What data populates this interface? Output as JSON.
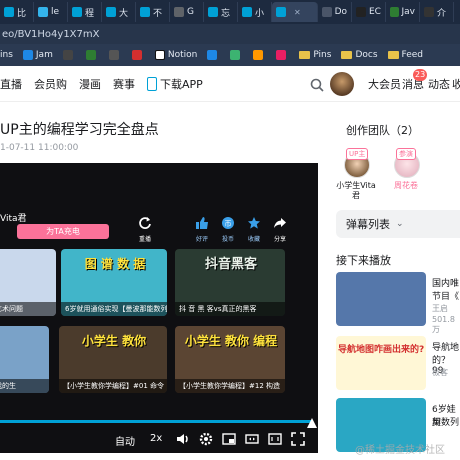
{
  "tabs": [
    {
      "label": "比",
      "color": "#00a1d6"
    },
    {
      "label": "le",
      "color": "#34b4eb"
    },
    {
      "label": "程",
      "color": "#00a1d6"
    },
    {
      "label": "大",
      "color": "#00a1d6"
    },
    {
      "label": "不",
      "color": "#00a1d6"
    },
    {
      "label": "G",
      "color": "#5f6368"
    },
    {
      "label": "忘",
      "color": "#00a1d6"
    },
    {
      "label": "小",
      "color": "#00a1d6"
    },
    {
      "label": "",
      "color": "#00a1d6"
    },
    {
      "label": "Do",
      "color": "#4a5568"
    },
    {
      "label": "EC",
      "color": "#222"
    },
    {
      "label": "Jav",
      "color": "#2e7d32"
    },
    {
      "label": "介",
      "color": "#333"
    }
  ],
  "url": "eo/BV1Ho4y1X7mX",
  "bookmarks": [
    {
      "label": "ins",
      "color": "#e06c75"
    },
    {
      "label": "Jam",
      "color": "#1e88e5"
    },
    {
      "label": "",
      "color": "#444"
    },
    {
      "label": "",
      "color": "#2e7d32"
    },
    {
      "label": "",
      "color": "#555"
    },
    {
      "label": "",
      "color": "#d32f2f"
    },
    {
      "label": "Notion",
      "color": "#fff"
    },
    {
      "label": "",
      "color": "#1e88e5"
    },
    {
      "label": "",
      "color": "#3cb371"
    },
    {
      "label": "",
      "color": "#ff9800"
    },
    {
      "label": "",
      "color": "#e91e63"
    }
  ],
  "bookmark_folders": [
    "Pins",
    "Docs",
    "Feed"
  ],
  "site_nav": {
    "links": [
      "直播",
      "会员购",
      "漫画",
      "赛事"
    ],
    "download_app": "下载APP",
    "vip": "大会员",
    "messages": "消息",
    "message_badge": "23",
    "dynamics": "动态",
    "favorites": "收"
  },
  "video": {
    "title": "UP主的编程学习完全盘点",
    "date": "1-07-11 11:00:00",
    "uploader_overlay": "Vita君",
    "charge_button": "为TA充电",
    "replay": "重播",
    "like": "好评",
    "coin": "投币",
    "favorite": "收藏",
    "share": "分享",
    "controls": {
      "auto": "自动",
      "speed": "2x"
    }
  },
  "end_screen": [
    {
      "caption": "的经济艺术问题",
      "bg": "#c9d8ec",
      "overlay": ""
    },
    {
      "caption": "6岁就用通俗实现【曼波那能数列】",
      "bg": "#41b5c9",
      "overlay": "图 谱 数 据"
    },
    {
      "caption": "抖 音 黑 客vs真正的黑客",
      "bg": "#2a3b32",
      "overlay": "抖音黑客"
    },
    {
      "caption": "，我，我的生",
      "bg": "#7aa2c8",
      "overlay": ""
    },
    {
      "caption": "【小学生教你学编程】#01 命令",
      "bg": "#4b3b2c",
      "overlay": "小学生 教你"
    },
    {
      "caption": "【小学生教你学编程】#12 构造",
      "bg": "#5b4533",
      "overlay": "小学生 教你 编程"
    }
  ],
  "sidebar": {
    "team_title": "创作团队（2）",
    "members": [
      {
        "tag": "UP主",
        "name": "小学生Vita君",
        "name_color": "#18191c"
      },
      {
        "tag": "参演",
        "name": "周花卷",
        "name_color": "#fb7299"
      }
    ],
    "danmaku": "弹幕列表",
    "next_play": "接下来播放",
    "recs": [
      {
        "title": "国内唯",
        "sub": "节目《",
        "author": "王启",
        "views": "501.8万",
        "bg": "#5577aa"
      },
      {
        "title": "导航地",
        "sub": "的？ 99",
        "author": "极客",
        "views": "",
        "bg": "#fff7d6"
      },
      {
        "title": "6岁娃用",
        "sub": "契数列",
        "author": "",
        "views": "",
        "bg": "#2aa7c4"
      }
    ],
    "rec2_overlay": "导航地图咋画出来的?"
  },
  "watermark": "@稀土掘金技术社区"
}
